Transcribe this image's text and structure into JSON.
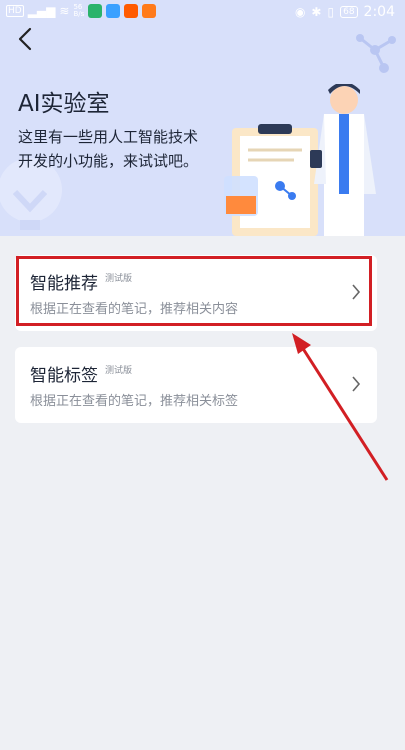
{
  "status_bar": {
    "time": "2:04",
    "battery": "68",
    "net_speed": "56\nB/s"
  },
  "header": {
    "title": "AI实验室",
    "description_line1": "这里有一些用人工智能技术",
    "description_line2": "开发的小功能，来试试吧。"
  },
  "features": [
    {
      "title": "智能推荐",
      "badge": "测试版",
      "description": "根据正在查看的笔记，推荐相关内容"
    },
    {
      "title": "智能标签",
      "badge": "测试版",
      "description": "根据正在查看的笔记，推荐相关标签"
    }
  ],
  "colors": {
    "header_bg": "#d8e0fa",
    "page_bg": "#eef0f4",
    "highlight": "#d21f24",
    "accent": "#3a7bf0"
  }
}
